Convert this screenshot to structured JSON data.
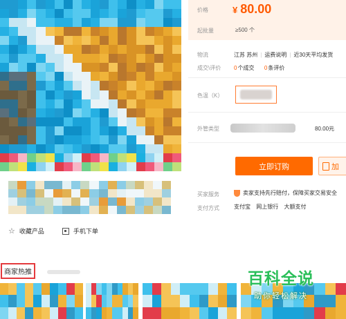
{
  "price_section": {
    "price_label": "价格",
    "currency": "¥",
    "price": "80.00",
    "moq_label": "起批量",
    "moq_value": "≥500 个"
  },
  "logistics": {
    "label": "物流",
    "location": "江苏 苏州",
    "freight_link": "运费说明",
    "delivery": "近30天平均发货"
  },
  "transactions": {
    "label": "成交\\评价",
    "deal_count": "0",
    "deal_text": "个成交",
    "review_count": "0",
    "review_text": "条评价"
  },
  "spec": {
    "label": "色温（K）"
  },
  "pipe": {
    "label": "外管类型",
    "price": "80.00元"
  },
  "buttons": {
    "order": "立即订购",
    "cart": "加"
  },
  "service": {
    "label": "买家服务",
    "text": "卖家支持先行赔付，保障买家交易安全"
  },
  "payment": {
    "label": "支付方式",
    "methods": [
      "支付宝",
      "网上银行",
      "大额支付"
    ]
  },
  "actions": {
    "favorite": "收藏产品",
    "mobile_order": "手机下单"
  },
  "recommend": {
    "title": "商家热推"
  },
  "watermark": {
    "big": "百科全说",
    "small": "助你轻松解决"
  },
  "colors": {
    "accent": "#ff6a00",
    "price_bg": "#fff2e8",
    "highlight_box": "#e4393c",
    "watermark_green": "#2bbf5a"
  }
}
